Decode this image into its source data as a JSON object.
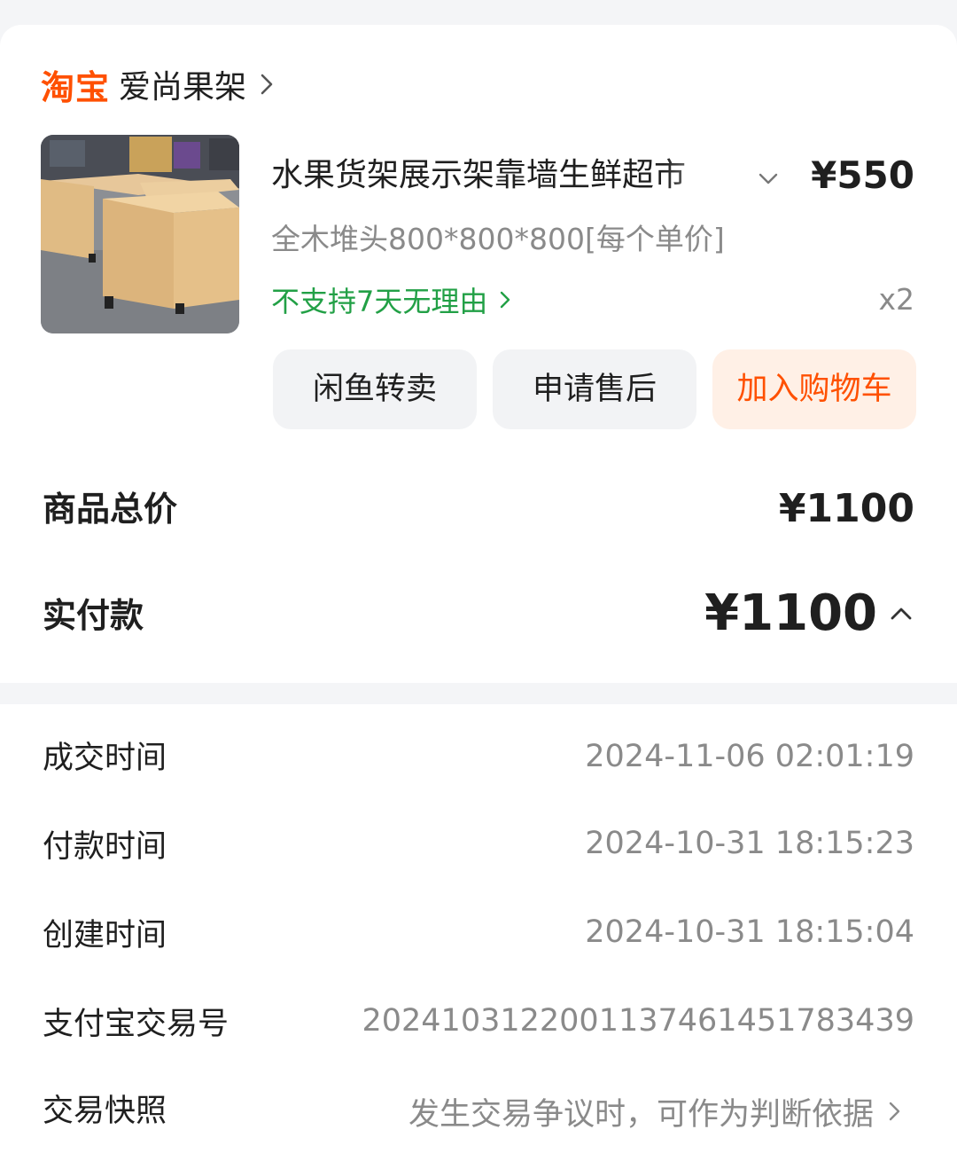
{
  "shop": {
    "platform_logo": "淘宝",
    "name": "爱尚果架",
    "arrow_icon": "chevron-right-icon"
  },
  "product": {
    "title": "水果货架展示架靠墙生鲜超市",
    "unit_price": "¥550",
    "spec": "全木堆头800*800*800[每个单价]",
    "return_policy": "不支持7天无理由",
    "quantity": "x2",
    "image_icon": "product-photo"
  },
  "actions": {
    "resell": "闲鱼转卖",
    "after_sale": "申请售后",
    "add_to_cart": "加入购物车"
  },
  "totals": {
    "goods_total_label": "商品总价",
    "goods_total_value": "¥1100",
    "paid_label": "实付款",
    "paid_value": "¥1100"
  },
  "order_info": {
    "deal_time_label": "成交时间",
    "deal_time": "2024-11-06 02:01:19",
    "pay_time_label": "付款时间",
    "pay_time": "2024-10-31 18:15:23",
    "create_time_label": "创建时间",
    "create_time": "2024-10-31 18:15:04",
    "alipay_no_label": "支付宝交易号",
    "alipay_no": "2024103122001137461451783439",
    "snapshot_label": "交易快照",
    "snapshot_hint": "发生交易争议时，可作为判断依据"
  },
  "colors": {
    "brand_orange": "#ff5000",
    "green": "#22a046",
    "grey_text": "#8a8a8a",
    "background": "#f4f5f7"
  }
}
